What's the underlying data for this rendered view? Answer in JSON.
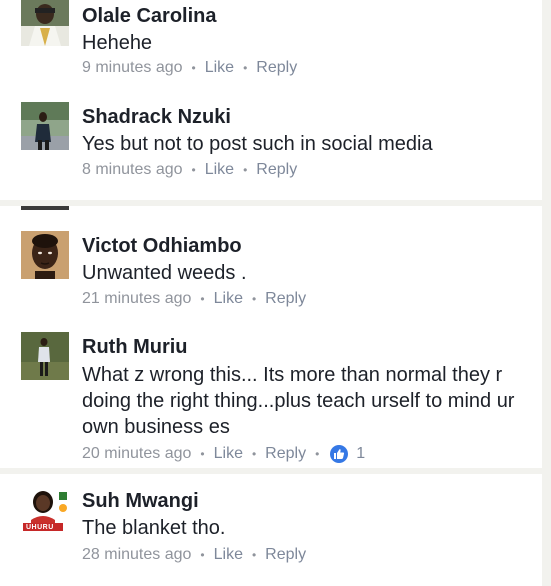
{
  "comments": [
    {
      "name": "Olale Carolina",
      "text": "Hehehe",
      "time": "9 minutes ago",
      "like": "Like",
      "reply": "Reply"
    },
    {
      "name": "Shadrack Nzuki",
      "text": "Yes but not to post such in social media",
      "time": "8 minutes ago",
      "like": "Like",
      "reply": "Reply"
    },
    {
      "name": "Victot Odhiambo",
      "text": "Unwanted weeds .",
      "time": "21 minutes ago",
      "like": "Like",
      "reply": "Reply"
    },
    {
      "name": "Ruth Muriu",
      "text": "What z wrong this... Its more than normal they r doing the right thing...plus teach urself to mind ur own business es",
      "time": "20 minutes ago",
      "like": "Like",
      "reply": "Reply",
      "reaction_count": "1"
    },
    {
      "name": "Suh Mwangi",
      "text": "The blanket tho.",
      "time": "28 minutes ago",
      "like": "Like",
      "reply": "Reply",
      "avatar_badge": "UHURU"
    }
  ],
  "colors": {
    "accent": "#3578e5",
    "meta": "#90949c",
    "name": "#1d2129",
    "divider": "#f2f2ee"
  }
}
